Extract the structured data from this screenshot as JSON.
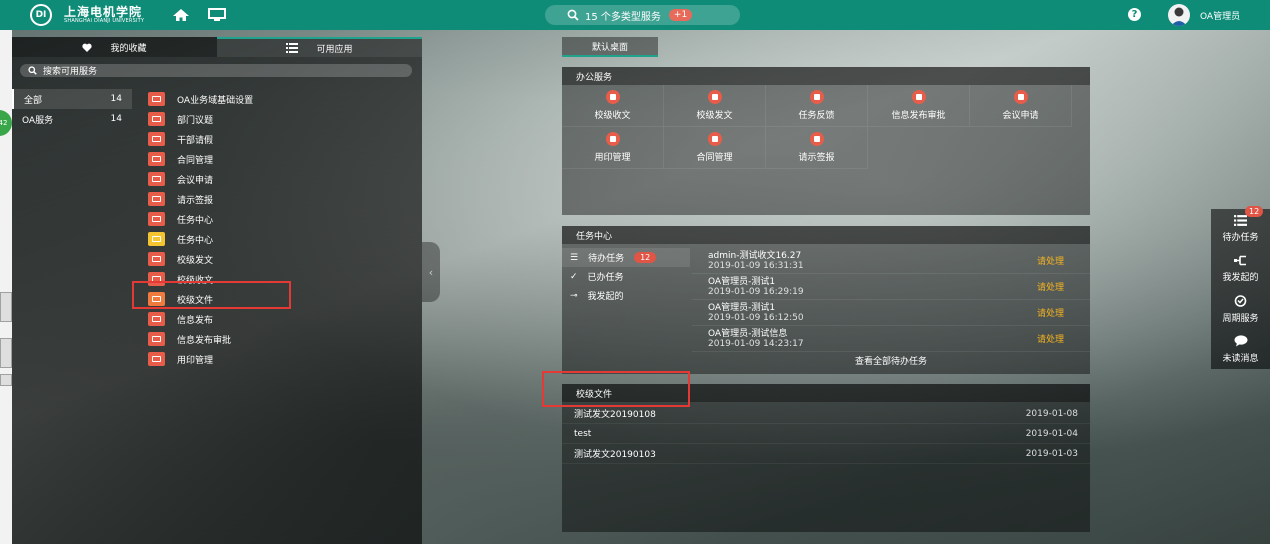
{
  "header": {
    "logo_mark": "DI",
    "logo_cn": "上海电机学院",
    "logo_en": "SHANGHAI DIANJI UNIVERSITY",
    "search_text": "15 个多类型服务",
    "search_count": "+1",
    "user_name": "OA管理员",
    "accent_color": "#0f8c78"
  },
  "left_panel": {
    "tab_favorites": "我的收藏",
    "tab_apps": "可用应用",
    "search_placeholder": "搜索可用服务",
    "categories": [
      {
        "label": "全部",
        "count": "14"
      },
      {
        "label": "OA服务",
        "count": "14"
      }
    ],
    "apps": [
      {
        "label": "OA业务域基础设置",
        "color": "#e85d4a",
        "icon": "settings-card-icon"
      },
      {
        "label": "部门议题",
        "color": "#e85d4a",
        "icon": "topic-icon"
      },
      {
        "label": "干部请假",
        "color": "#e85d4a",
        "icon": "leave-icon"
      },
      {
        "label": "合同管理",
        "color": "#e85d4a",
        "icon": "contract-icon"
      },
      {
        "label": "会议申请",
        "color": "#e85d4a",
        "icon": "meeting-icon"
      },
      {
        "label": "请示签报",
        "color": "#e85d4a",
        "icon": "report-icon"
      },
      {
        "label": "任务中心",
        "color": "#e85d4a",
        "icon": "task-icon"
      },
      {
        "label": "任务中心",
        "color": "#f5c431",
        "icon": "task-grid-icon"
      },
      {
        "label": "校级发文",
        "color": "#e85d4a",
        "icon": "send-doc-icon"
      },
      {
        "label": "校级收文",
        "color": "#e85d4a",
        "icon": "receive-doc-icon"
      },
      {
        "label": "校级文件",
        "color": "#f07b3f",
        "icon": "folder-icon"
      },
      {
        "label": "信息发布",
        "color": "#e85d4a",
        "icon": "publish-icon"
      },
      {
        "label": "信息发布审批",
        "color": "#e85d4a",
        "icon": "approve-icon"
      },
      {
        "label": "用印管理",
        "color": "#e85d4a",
        "icon": "seal-icon"
      }
    ]
  },
  "desktop": {
    "tab_label": "默认桌面",
    "office": {
      "title": "办公服务",
      "items": [
        "校级收文",
        "校级发文",
        "任务反馈",
        "信息发布审批",
        "会议申请",
        "用印管理",
        "合同管理",
        "请示签报"
      ]
    },
    "tasks": {
      "title": "任务中心",
      "menu": [
        {
          "label": "待办任务",
          "badge": "12"
        },
        {
          "label": "已办任务",
          "badge": ""
        },
        {
          "label": "我发起的",
          "badge": ""
        }
      ],
      "list": [
        {
          "title": "admin-测试收文16.27",
          "time": "2019-01-09 16:31:31",
          "status": "请处理"
        },
        {
          "title": "OA管理员-测试1",
          "time": "2019-01-09 16:29:19",
          "status": "请处理"
        },
        {
          "title": "OA管理员-测试1",
          "time": "2019-01-09 16:12:50",
          "status": "请处理"
        },
        {
          "title": "OA管理员-测试信息",
          "time": "2019-01-09 14:23:17",
          "status": "请处理"
        }
      ],
      "view_all": "查看全部待办任务"
    },
    "documents": {
      "title": "校级文件",
      "rows": [
        {
          "name": "测试发文20190108",
          "date": "2019-01-08"
        },
        {
          "name": "test",
          "date": "2019-01-04"
        },
        {
          "name": "测试发文20190103",
          "date": "2019-01-03"
        }
      ]
    }
  },
  "right_bar": {
    "items": [
      {
        "label": "待办任务",
        "badge": "12"
      },
      {
        "label": "我发起的",
        "badge": ""
      },
      {
        "label": "周期服务",
        "badge": ""
      },
      {
        "label": "未读消息",
        "badge": ""
      }
    ]
  },
  "edge_widget": "42"
}
